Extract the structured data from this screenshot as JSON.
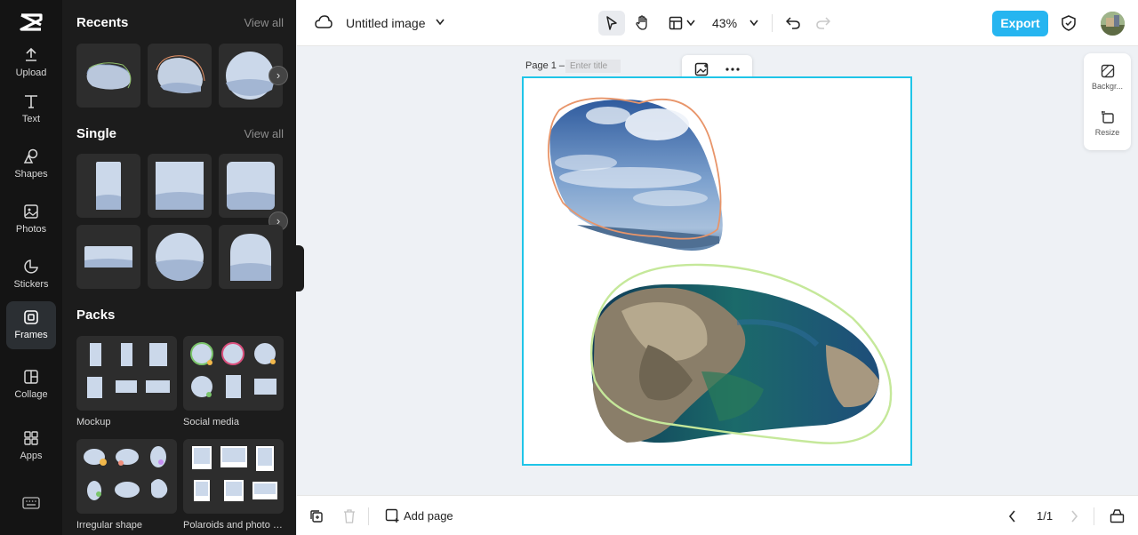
{
  "rail": {
    "items": [
      {
        "label": "Upload",
        "icon": "upload-icon"
      },
      {
        "label": "Text",
        "icon": "text-icon"
      },
      {
        "label": "Shapes",
        "icon": "shapes-icon"
      },
      {
        "label": "Photos",
        "icon": "photos-icon"
      },
      {
        "label": "Stickers",
        "icon": "stickers-icon"
      },
      {
        "label": "Frames",
        "icon": "frames-icon",
        "active": true
      },
      {
        "label": "Collage",
        "icon": "collage-icon"
      },
      {
        "label": "Apps",
        "icon": "apps-icon"
      }
    ]
  },
  "panel": {
    "recents_title": "Recents",
    "recents_view_all": "View all",
    "single_title": "Single",
    "single_view_all": "View all",
    "packs_title": "Packs",
    "packs": [
      "Mockup",
      "Social media",
      "Irregular shape",
      "Polaroids and photo f..."
    ]
  },
  "topbar": {
    "doc_title": "Untitled image",
    "zoom": "43%",
    "export_label": "Export"
  },
  "canvas": {
    "page_label": "Page 1 –",
    "page_title_placeholder": "Enter title"
  },
  "side_tools": {
    "background_label": "Backgr...",
    "resize_label": "Resize"
  },
  "bottombar": {
    "add_page_label": "Add page",
    "pager": "1/1"
  },
  "colors": {
    "accent": "#26b5f0",
    "selection": "#1fc5e8",
    "orange_outline": "#e8956a",
    "green_outline": "#c5e89a"
  }
}
